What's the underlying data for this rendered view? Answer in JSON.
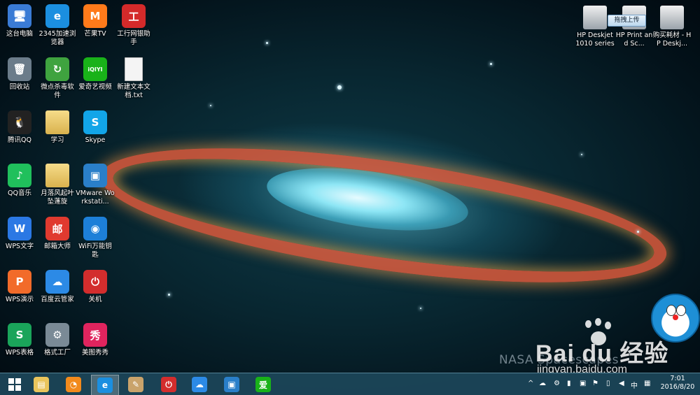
{
  "desktop_icons": [
    {
      "label": "这台电脑",
      "color": "#3a7bd5",
      "glyph": "🖥"
    },
    {
      "label": "2345加速浏览器",
      "color": "#1b8fe0",
      "glyph": "e"
    },
    {
      "label": "芒果TV",
      "color": "#ff7a1a",
      "glyph": "M"
    },
    {
      "label": "工行网银助手",
      "color": "#d42a2a",
      "glyph": "工"
    },
    {
      "label": "回收站",
      "color": "#6b7c8a",
      "glyph": "🗑"
    },
    {
      "label": "微点杀毒软件",
      "color": "#3fa33f",
      "glyph": "↻"
    },
    {
      "label": "爱奇艺视频",
      "color": "#19b219",
      "glyph": "iQIYI"
    },
    {
      "label": "新建文本文档.txt",
      "color": "#eeeeee",
      "glyph": ""
    },
    {
      "label": "腾讯QQ",
      "color": "#222222",
      "glyph": "🐧"
    },
    {
      "label": "学习",
      "color": "#e6c36a",
      "glyph": ""
    },
    {
      "label": "Skype",
      "color": "#12a5e8",
      "glyph": "S"
    },
    {
      "label": "QQ音乐",
      "color": "#20c05c",
      "glyph": "♪"
    },
    {
      "label": "月落风起叶坠蓬旋",
      "color": "#e6c36a",
      "glyph": ""
    },
    {
      "label": "VMware Workstati...",
      "color": "#2a7fc9",
      "glyph": "▣"
    },
    {
      "label": "WPS文字",
      "color": "#2b78e4",
      "glyph": "W"
    },
    {
      "label": "邮箱大师",
      "color": "#e03a2f",
      "glyph": "邮"
    },
    {
      "label": "WiFi万能钥匙",
      "color": "#1d7fd8",
      "glyph": "◉"
    },
    {
      "label": "WPS演示",
      "color": "#f26b2a",
      "glyph": "P"
    },
    {
      "label": "百度云管家",
      "color": "#2c8ae6",
      "glyph": "☁"
    },
    {
      "label": "关机",
      "color": "#d32d2d",
      "glyph": "⏻"
    },
    {
      "label": "WPS表格",
      "color": "#1aa45a",
      "glyph": "S"
    },
    {
      "label": "格式工厂",
      "color": "#7a8a96",
      "glyph": "⚙"
    },
    {
      "label": "美图秀秀",
      "color": "#e0245e",
      "glyph": "秀"
    }
  ],
  "printer_icons": [
    {
      "label": "HP Deskjet 1010 series"
    },
    {
      "label": "HP Print and Sc..."
    },
    {
      "label": "购买耗材 - HP Deskj..."
    }
  ],
  "upload_tip": "拖拽上传",
  "watermark": {
    "nasa": "NASA Spacescapes",
    "baidu": "Bai du 经验",
    "url": "jingyan.baidu.com"
  },
  "taskbar": {
    "apps": [
      {
        "name": "file-explorer",
        "color": "#e9c45c",
        "glyph": "▤"
      },
      {
        "name": "wifi-key",
        "color": "#f28a1c",
        "glyph": "◔"
      },
      {
        "name": "2345-browser",
        "color": "#1b8fe0",
        "glyph": "e"
      },
      {
        "name": "paint",
        "color": "#c9a36b",
        "glyph": "✎"
      },
      {
        "name": "shutdown",
        "color": "#d32d2d",
        "glyph": "⏻"
      },
      {
        "name": "baidu-cloud",
        "color": "#2c8ae6",
        "glyph": "☁"
      },
      {
        "name": "vmware",
        "color": "#2a7fc9",
        "glyph": "▣"
      },
      {
        "name": "iqiyi",
        "color": "#19b219",
        "glyph": "爱"
      }
    ],
    "tray_ime": "中",
    "time": "7:01",
    "date": "2016/8/20"
  }
}
